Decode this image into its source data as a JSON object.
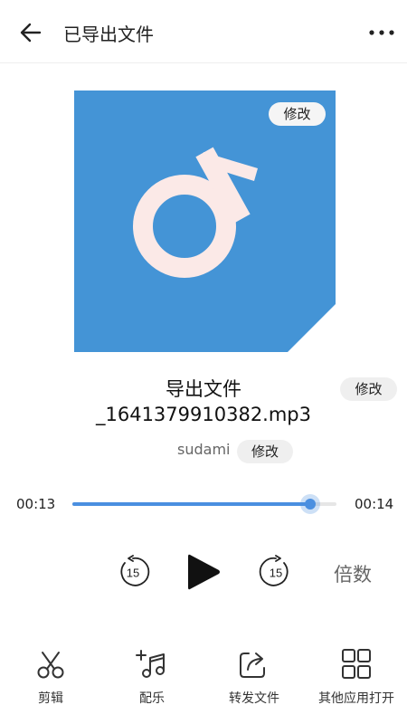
{
  "header": {
    "title": "已导出文件",
    "back_icon": "arrow-left-icon",
    "more_icon": "more-horizontal-icon"
  },
  "cover": {
    "background_color": "#4494d6",
    "note_color": "#fbe9e7",
    "edit_label": "修改"
  },
  "track": {
    "name": "导出文件_1641379910382.mp3",
    "name_edit_label": "修改",
    "artist": "sudami",
    "artist_edit_label": "修改"
  },
  "player": {
    "current_time": "00:13",
    "total_time": "00:14",
    "progress_percent": 90,
    "rewind_seconds": "15",
    "forward_seconds": "15",
    "speed_label": "倍数",
    "accent_color": "#4a8fe0"
  },
  "toolbar": {
    "items": [
      {
        "label": "剪辑",
        "icon": "scissors-icon"
      },
      {
        "label": "配乐",
        "icon": "music-add-icon"
      },
      {
        "label": "转发文件",
        "icon": "share-icon"
      },
      {
        "label": "其他应用打开",
        "icon": "grid-icon"
      }
    ]
  }
}
